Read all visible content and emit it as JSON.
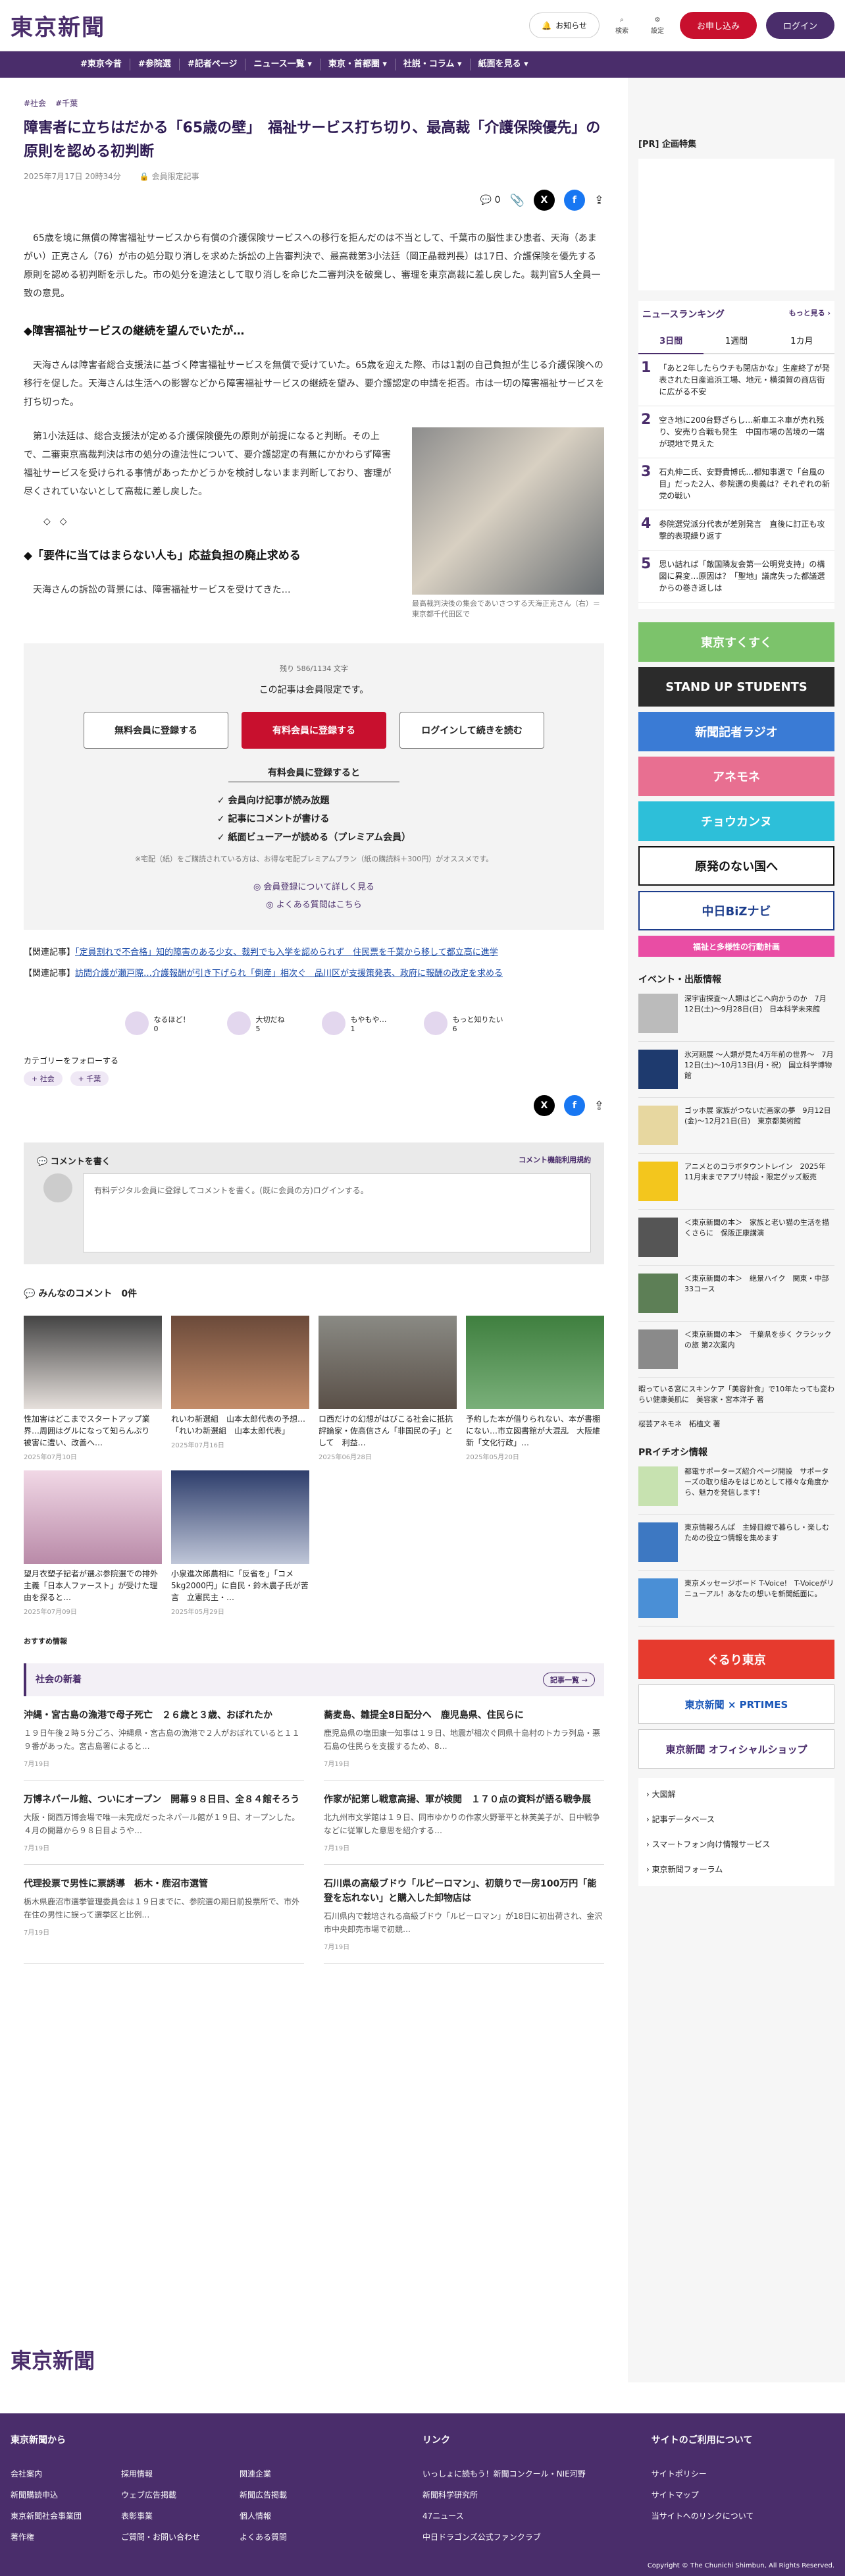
{
  "header": {
    "logo": "東京新聞",
    "notice": "お知らせ",
    "search": "検索",
    "settings": "設定",
    "register": "お申し込み",
    "login": "ログイン"
  },
  "nav": [
    "#東京今昔",
    "#参院選",
    "#記者ページ",
    "ニュース一覧 ▾",
    "東京・首都圏 ▾",
    "社説・コラム ▾",
    "紙面を見る ▾"
  ],
  "article": {
    "tags": [
      "#社会",
      "#千葉"
    ],
    "title": "障害者に立ちはだかる「65歳の壁」　福祉サービス打ち切り、最高裁「介護保険優先」の原則を認める初判断",
    "date": "2025年7月17日 20時34分",
    "member": "会員限定記事",
    "comments": "0",
    "p1": "65歳を境に無償の障害福祉サービスから有償の介護保険サービスへの移行を拒んだのは不当として、千葉市の脳性まひ患者、天海（あまがい）正克さん（76）が市の処分取り消しを求めた訴訟の上告審判決で、最高裁第3小法廷（岡正晶裁判長）は17日、介護保険を優先する原則を認める初判断を示した。市の処分を違法として取り消しを命じた二審判決を破棄し、審理を東京高裁に差し戻した。裁判官5人全員一致の意見。",
    "h1": "◆障害福祉サービスの継続を望んでいたが…",
    "p2": "天海さんは障害者総合支援法に基づく障害福祉サービスを無償で受けていた。65歳を迎えた際、市は1割の自己負担が生じる介護保険への移行を促した。天海さんは生活への影響などから障害福祉サービスの継続を望み、要介護認定の申請を拒否。市は一切の障害福祉サービスを打ち切った。",
    "p3": "第1小法廷は、総合支援法が定める介護保険優先の原則が前提になると判断。その上で、二審東京高裁判決は市の処分の違法性について、要介護認定の有無にかかわらず障害福祉サービスを受けられる事情があったかどうかを検討しないまま判断しており、審理が尽くされていないとして高裁に差し戻した。",
    "dots": "◇　◇",
    "h2": "◆「要件に当てはまらない人も」応益負担の廃止求める",
    "p4": "天海さんの訴訟の背景には、障害福祉サービスを受けてきた…",
    "photo_caption": "最高裁判決後の集会であいさつする天海正克さん（右）＝東京都千代田区で"
  },
  "paywall": {
    "count": "残り 586/1134 文字",
    "msg": "この記事は会員限定です。",
    "b1": "無料会員に登録する",
    "b2": "有料会員に登録する",
    "b3": "ログインして続きを読む",
    "sub": "有料会員に登録すると",
    "items": [
      "✓ 会員向け記事が読み放題",
      "✓ 記事にコメントが書ける",
      "✓ 紙面ビューアーが読める（プレミアム会員）"
    ],
    "note": "※宅配（紙）をご購読されている方は、お得な宅配プレミアムプラン（紙の購読料＋300円）がオススメです。",
    "link1": "◎ 会員登録について詳しく見る",
    "link2": "◎ よくある質問はこちら"
  },
  "related": [
    {
      "label": "【関連記事】",
      "text": "「定員割れで不合格」知的障害のある少女、裁判でも入学を認められず　住民票を千葉から移して都立高に進学"
    },
    {
      "label": "【関連記事】",
      "text": "訪問介護が瀬戸際…介護報酬が引き下げられ「倒産」相次ぐ　品川区が支援策発表、政府に報酬の改定を求める"
    }
  ],
  "reactions": [
    {
      "l": "なるほど！",
      "n": "0"
    },
    {
      "l": "大切だね",
      "n": "5"
    },
    {
      "l": "もやもや…",
      "n": "1"
    },
    {
      "l": "もっと知りたい",
      "n": "6"
    }
  ],
  "follow": {
    "title": "カテゴリーをフォローする",
    "chips": [
      "+ 社会",
      "+ 千葉"
    ]
  },
  "comment_box": {
    "title": "コメントを書く",
    "rules": "コメント機能利用規約",
    "prompt": "有料デジタル会員に登録してコメントを書く。(既に会員の方)ログインする。"
  },
  "all_comments": {
    "title": "みんなのコメント",
    "count": "0件"
  },
  "cards": [
    {
      "t": "性加害はどこまでスタートアップ業界…周囲はグルになって知らんぷり　被害に遭い、改善へ…",
      "d": "2025年07月10日"
    },
    {
      "t": "れいわ新選組　山本太郎代表の予想…「れいわ新選組　山本太郎代表」",
      "d": "2025年07月16日"
    },
    {
      "t": "ロ西だけの幻想がはびこる社会に抵抗　評論家・佐高信さん「非国民の子」として　利益…",
      "d": "2025年06月28日"
    },
    {
      "t": "予約した本が借りられない、本が書棚にない…市立図書館が大混乱　大阪維新「文化行政」…",
      "d": "2025年05月20日"
    },
    {
      "t": "望月衣塑子記者が選ぶ参院選での排外主義「日本人ファースト」が受けた理由を探ると…",
      "d": "2025年07月09日"
    },
    {
      "t": "小泉進次郎農相に「反省を」「コメ5kg2000円」に自民・鈴木農子氏が苦言　立憲民主・…",
      "d": "2025年05月29日"
    }
  ],
  "recommend": "おすすめ情報",
  "society": {
    "title": "社会の新着",
    "more": "記事一覧 →",
    "items": [
      {
        "h": "沖縄・宮古島の漁港で母子死亡　２６歳と３歳、おぼれたか",
        "p": "１９日午後２時５分ごろ、沖縄県・宮古島の漁港で２人がおぼれていると１１９番があった。宮古島署によると…",
        "d": "7月19日"
      },
      {
        "h": "蕎麦島、雛提全8日配分へ　鹿児島県、住民らに",
        "p": "鹿児島県の塩田康一知事は１９日、地震が相次ぐ同県十島村のトカラ列島・悪石島の住民らを支援するため、8…",
        "d": "7月19日"
      },
      {
        "h": "万博ネパール館、ついにオープン　開幕９８日目、全８４館そろう",
        "p": "大阪・関西万博会場で唯一未完成だったネパール館が１９日、オープンした。４月の開幕から９８日目ようや…",
        "d": "7月19日"
      },
      {
        "h": "作家が記第し戦意高揚、軍が検閲　１７０点の資料が語る戦争展",
        "p": "北九州市文学館は１９日、同市ゆかりの作家火野葦平と林芙美子が、日中戦争などに従軍した意思を紹介する…",
        "d": "7月19日"
      },
      {
        "h": "代理投票で男性に票誘導　栃木・鹿沼市選管",
        "p": "栃木県鹿沼市選挙管理委員会は１９日までに、参院選の期日前投票所で、市外在住の男性に誤って選挙区と比例…",
        "d": "7月19日"
      },
      {
        "h": "石川県の高級ブドウ「ルビーロマン」、初競りで一房100万円「能登を忘れない」と購入した卸物店は",
        "p": "石川県内で栽培される高級ブドウ「ルビーロマン」が18日に初出荷され、金沢市中央卸売市場で初競…",
        "d": "7月19日"
      }
    ]
  },
  "side": {
    "pr": "[PR] 企画特集",
    "rank_title": "ニュースランキング",
    "rank_more": "もっと見る ›",
    "tabs": [
      "3日間",
      "1週間",
      "1カ月"
    ],
    "ranks": [
      "「あと2年したらウチも閉店かな」生産終了が発表された日産追浜工場、地元・横須賀の商店街に広がる不安",
      "空き地に200台野ざらし…新車エネ車が売れ残り、安売り合戦も発生　中国市場の苦境の一端が現地で見えた",
      "石丸伸二氏、安野貴博氏…都知事選で「台風の目」だった2人、参院選の奥義は？それぞれの新党の戦い",
      "参院選党派分代表が差別発言　直後に訂正も攻撃的表現繰り返す",
      "思い詰れば「敵国隣友会第一公明党支持」の構図に異変…原因は？「聖地」議席失った都議選からの巻き返しは"
    ],
    "banners": [
      "東京すくすく",
      "STAND UP STUDENTS",
      "新聞記者ラジオ",
      "アネモネ",
      "チョウカンヌ",
      "原発のない国へ",
      "中日BiZナビ",
      "福祉と多様性の行動計画"
    ],
    "events_title": "イベント・出版情報",
    "events": [
      "深宇宙探査〜人類はどこへ向かうのか　7月12日(土)〜9月28日(日)　日本科学未来館",
      "氷河期展 〜人類が見た4万年前の世界〜　7月12日(土)〜10月13日(月・祝)　国立科学博物館",
      "ゴッホ展 家族がつないだ画家の夢　9月12日(金)〜12月21日(日)　東京都美術館",
      "アニメとのコラボタウントレイン　2025年11月末までアプリ特設・限定グッズ販売",
      "＜東京新聞の本＞　家族と老い猫の生活を描くさらに　保阪正康講演",
      "＜東京新聞の本＞　絶景ハイク　関東・中部33コース",
      "＜東京新聞の本＞　千葉県を歩く クラシックの旅 第2次案内"
    ],
    "other": "暇っている宮にスキンケア「美容針食」で10年たっても変わらい健康美肌に　美容家・宮本洋子 著",
    "other2": "桜芸アネモネ　柘植文 著",
    "pr2": "PRイチオシ情報",
    "prs": [
      "都電サポーターズ紹介ページ開設　サポーターズの取り組みをはじめとして様々な角度から、魅力を発信します！",
      "東京情報ろんぱ　主婦目線で暮らし・楽しむための役立つ情報を集めます",
      "東京メッセージボード T-Voice!　T-Voiceがリニューアル！あなたの想いを新聞紙面に。"
    ],
    "links": [
      "大図解",
      "記事データベース",
      "スマートフォン向け情報サービス",
      "東京新聞フォーラム"
    ],
    "gurutokyo": "ぐるり東京",
    "prtimes": "東京新聞 × PRTIMES",
    "shop": "東京新聞 オフィシャルショップ"
  },
  "footer": {
    "col1": "東京新聞から",
    "col2": "リンク",
    "col3": "サイトのご利用について",
    "items1": [
      "会社案内",
      "新聞購読申込",
      "東京新聞社会事業団",
      "著作権"
    ],
    "items1b": [
      "採用情報",
      "ウェブ広告掲載",
      "表彰事業",
      "ご質問・お問い合わせ"
    ],
    "items1c": [
      "関連企業",
      "新聞広告掲載",
      "個人情報",
      "よくある質問"
    ],
    "items2": [
      "いっしょに読もう！新聞コンクール・NIE河野",
      "新聞科学研究所",
      "47ニュース",
      "中日ドラゴンズ公式ファンクラブ"
    ],
    "items3": [
      "サイトポリシー",
      "サイトマップ",
      "当サイトへのリンクについて"
    ],
    "copyright": "Copyright © The Chunichi Shimbun, All Rights Reserved."
  }
}
